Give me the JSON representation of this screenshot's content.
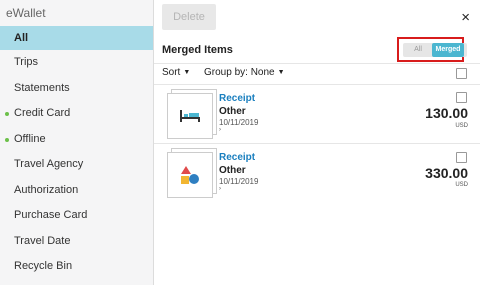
{
  "sidebar": {
    "title": "eWallet",
    "items": [
      {
        "label": "All",
        "active": true,
        "dot": false
      },
      {
        "label": "Trips",
        "active": false,
        "dot": false
      },
      {
        "label": "Statements",
        "active": false,
        "dot": false
      },
      {
        "label": "Credit Card",
        "active": false,
        "dot": true
      },
      {
        "label": "Offline",
        "active": false,
        "dot": true
      },
      {
        "label": "Travel Agency",
        "active": false,
        "dot": false
      },
      {
        "label": "Authorization",
        "active": false,
        "dot": false
      },
      {
        "label": "Purchase Card",
        "active": false,
        "dot": false
      },
      {
        "label": "Travel Date",
        "active": false,
        "dot": false
      },
      {
        "label": "Recycle Bin",
        "active": false,
        "dot": false
      }
    ]
  },
  "toolbar": {
    "delete_label": "Delete",
    "close_icon": "×"
  },
  "header": {
    "title": "Merged Items",
    "toggle_all": "All",
    "toggle_merged": "Merged",
    "toggle_selected": "Merged"
  },
  "controls": {
    "sort_label": "Sort",
    "groupby_label": "Group by: None",
    "caret": "▼"
  },
  "items": [
    {
      "type": "Receipt",
      "category": "Other",
      "date": "10/11/2019",
      "arrow": "›",
      "amount": "130.00",
      "currency": "USD",
      "icon": "bed-icon"
    },
    {
      "type": "Receipt",
      "category": "Other",
      "date": "10/11/2019",
      "arrow": "›",
      "amount": "330.00",
      "currency": "USD",
      "icon": "shapes-icon"
    }
  ],
  "colors": {
    "accent": "#4bb6d0",
    "active_bg": "#a8dbe8",
    "link": "#1a7fbf",
    "dot": "#6cc04a",
    "highlight": "#d81c1c"
  }
}
